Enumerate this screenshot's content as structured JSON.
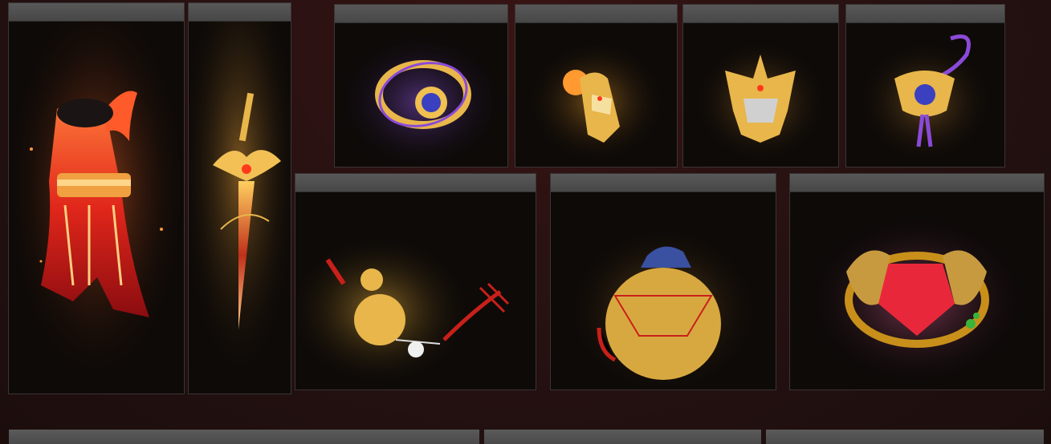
{
  "items": [
    {
      "name": "",
      "icon": "red-robe-armor-icon"
    },
    {
      "name": "",
      "icon": "golden-sword-icon"
    },
    {
      "name": "",
      "icon": "golden-bracelet-icon"
    },
    {
      "name": "",
      "icon": "golden-gauntlet-icon"
    },
    {
      "name": "",
      "icon": "golden-helmet-icon"
    },
    {
      "name": "",
      "icon": "golden-amulet-icon"
    },
    {
      "name": "",
      "icon": "golden-gourd-charm-icon"
    },
    {
      "name": "",
      "icon": "golden-pouch-icon"
    },
    {
      "name": "",
      "icon": "dragon-ring-icon"
    }
  ],
  "footer_slots": [
    {
      "name": ""
    },
    {
      "name": ""
    },
    {
      "name": ""
    }
  ],
  "colors": {
    "background": "#261111",
    "card": "#0e0a08",
    "header_bar": "#4f4f4f",
    "gold": "#e8b64a",
    "crimson": "#c8201a",
    "violet": "#8a4ad8"
  }
}
